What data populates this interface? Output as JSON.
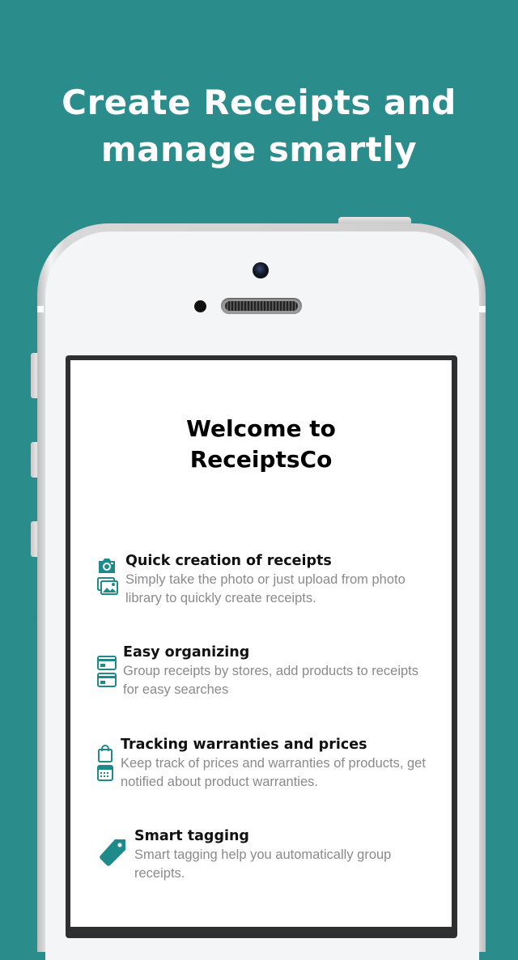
{
  "headline": {
    "line1": "Create Receipts and",
    "line2": "manage smartly"
  },
  "screen": {
    "welcome_line1": "Welcome to",
    "welcome_line2": "ReceiptsCo",
    "features": [
      {
        "title": "Quick creation of receipts",
        "description": "Simply take the photo or just upload from photo library to quickly create receipts.",
        "icons": [
          "camera-icon",
          "photo-library-icon"
        ]
      },
      {
        "title": "Easy organizing",
        "description": "Group receipts by stores, add products to receipts for easy searches",
        "icons": [
          "card-icon",
          "card-icon"
        ]
      },
      {
        "title": "Tracking warranties and prices",
        "description": "Keep track of prices and warranties of products, get notified about product warranties.",
        "icons": [
          "shopping-bag-icon",
          "calendar-icon"
        ]
      },
      {
        "title": "Smart tagging",
        "description": "Smart tagging help you automatically group receipts.",
        "icons": [
          "tag-icon"
        ]
      }
    ]
  },
  "colors": {
    "background": "#2b8c8c",
    "accent": "#1f8a8a",
    "title": "#111111",
    "description": "#8a8a8e"
  }
}
